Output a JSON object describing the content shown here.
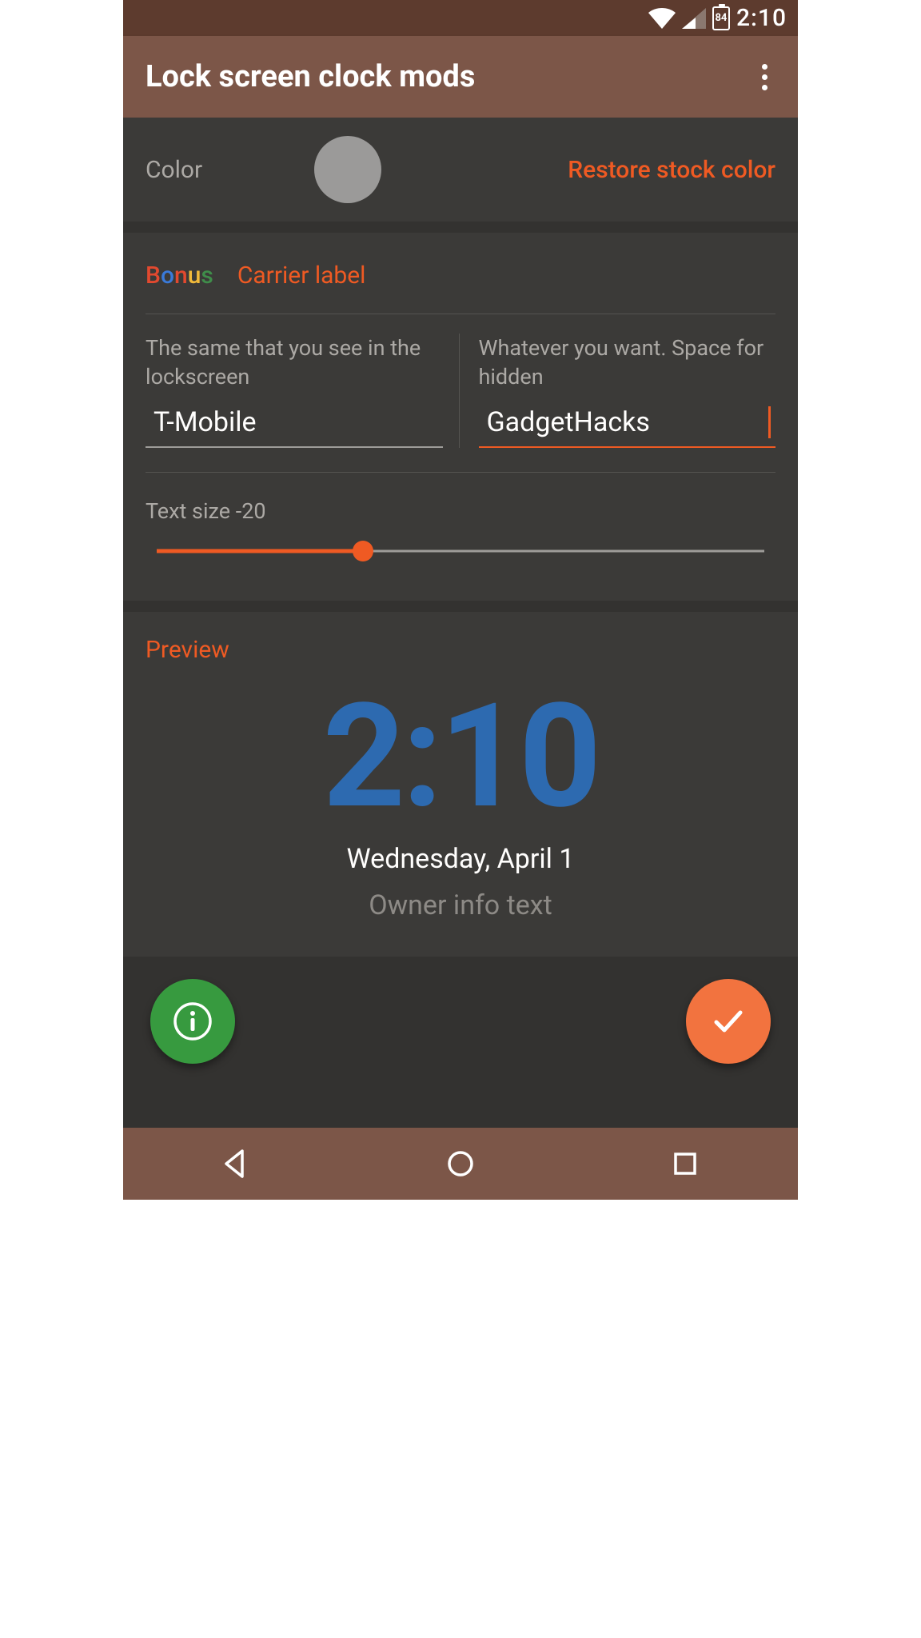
{
  "status": {
    "time": "2:10",
    "battery_pct": "84"
  },
  "appbar": {
    "title": "Lock screen clock mods"
  },
  "colorRow": {
    "label": "Color",
    "restore": "Restore stock color",
    "swatch": "#9b9a99"
  },
  "bonus": {
    "word": [
      "B",
      "o",
      "n",
      "u",
      "s"
    ],
    "label": "Carrier label",
    "left": {
      "desc": "The same that you see in the lockscreen",
      "value": "T-Mobile"
    },
    "right": {
      "desc": "Whatever you want. Space for hidden",
      "value": "GadgetHacks"
    },
    "slider": {
      "label": "Text size -20",
      "percent": 34
    }
  },
  "preview": {
    "title": "Preview",
    "time": "2:10",
    "date": "Wednesday, April 1",
    "owner": "Owner info text",
    "clock_color": "#2d6ab0"
  }
}
